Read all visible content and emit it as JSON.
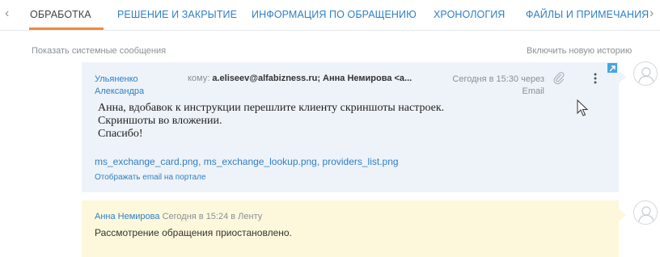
{
  "tabs": {
    "items": [
      {
        "label": "ОБРАБОТКА",
        "active": true
      },
      {
        "label": "РЕШЕНИЕ И ЗАКРЫТИЕ"
      },
      {
        "label": "ИНФОРМАЦИЯ ПО ОБРАЩЕНИЮ"
      },
      {
        "label": "ХРОНОЛОГИЯ"
      },
      {
        "label": "ФАЙЛЫ И ПРИМЕЧАНИЯ"
      }
    ],
    "prev_arrow": "‹",
    "next_arrow": "›"
  },
  "history": {
    "show_system_messages": "Показать системные сообщения",
    "enable_new_history": "Включить новую историю"
  },
  "email": {
    "sender_line1": "Ульяненко",
    "sender_line2": "Александра",
    "to_label": "кому:",
    "to_recipients": "a.eliseev@alfabizness.ru; Анна Немирова <a...",
    "time_line1": "Сегодня в 15:30 через",
    "time_line2": "Email",
    "body_lines": [
      "Анна, вдобавок к инструкции перешлите клиенту скриншоты настроек.",
      "Скриншоты во вложении.",
      "Спасибо!"
    ],
    "attachments": "ms_exchange_card.png, ms_exchange_lookup.png, providers_list.png",
    "portal_link": "Отображать email на портале"
  },
  "feed": {
    "author": "Анна Немирова",
    "meta": "Сегодня в 15:24 в Ленту",
    "text": "Рассмотрение обращения приостановлено."
  },
  "colors": {
    "accent": "#f08b3a",
    "link": "#2f7fc4",
    "email_bg": "#eef3f9",
    "feed_bg": "#fdf8dc"
  }
}
